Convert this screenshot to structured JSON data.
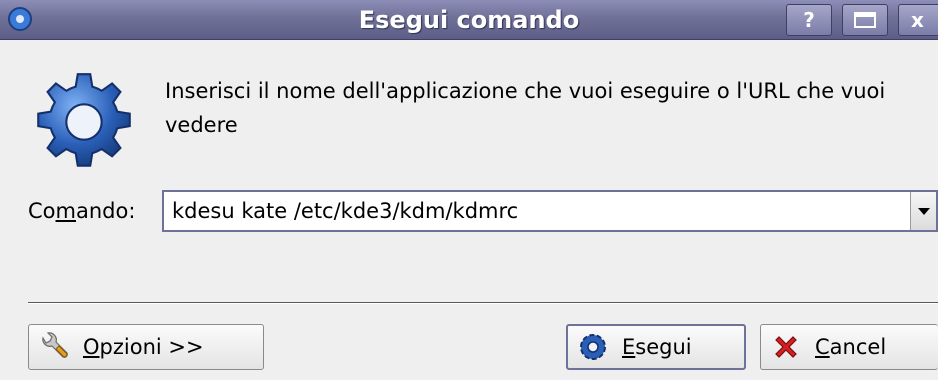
{
  "window": {
    "title": "Esegui comando",
    "help_button": "?",
    "close_button": "x"
  },
  "dialog": {
    "description": "Inserisci il nome dell'applicazione che vuoi eseguire o l'URL che vuoi vedere",
    "command_label": {
      "before": "Co",
      "mnemonic": "m",
      "after": "ando:"
    },
    "command_value": "kdesu kate /etc/kde3/kdm/kdmrc"
  },
  "buttons": {
    "options": {
      "mnemonic": "O",
      "rest": "pzioni >>"
    },
    "run": {
      "mnemonic": "E",
      "rest": "segui"
    },
    "cancel": {
      "mnemonic": "C",
      "rest": "ancel"
    }
  },
  "colors": {
    "titlebar": "#6f7198",
    "window_bg": "#efefef",
    "gear_blue": "#2a5fb8",
    "cancel_red": "#d42020"
  }
}
